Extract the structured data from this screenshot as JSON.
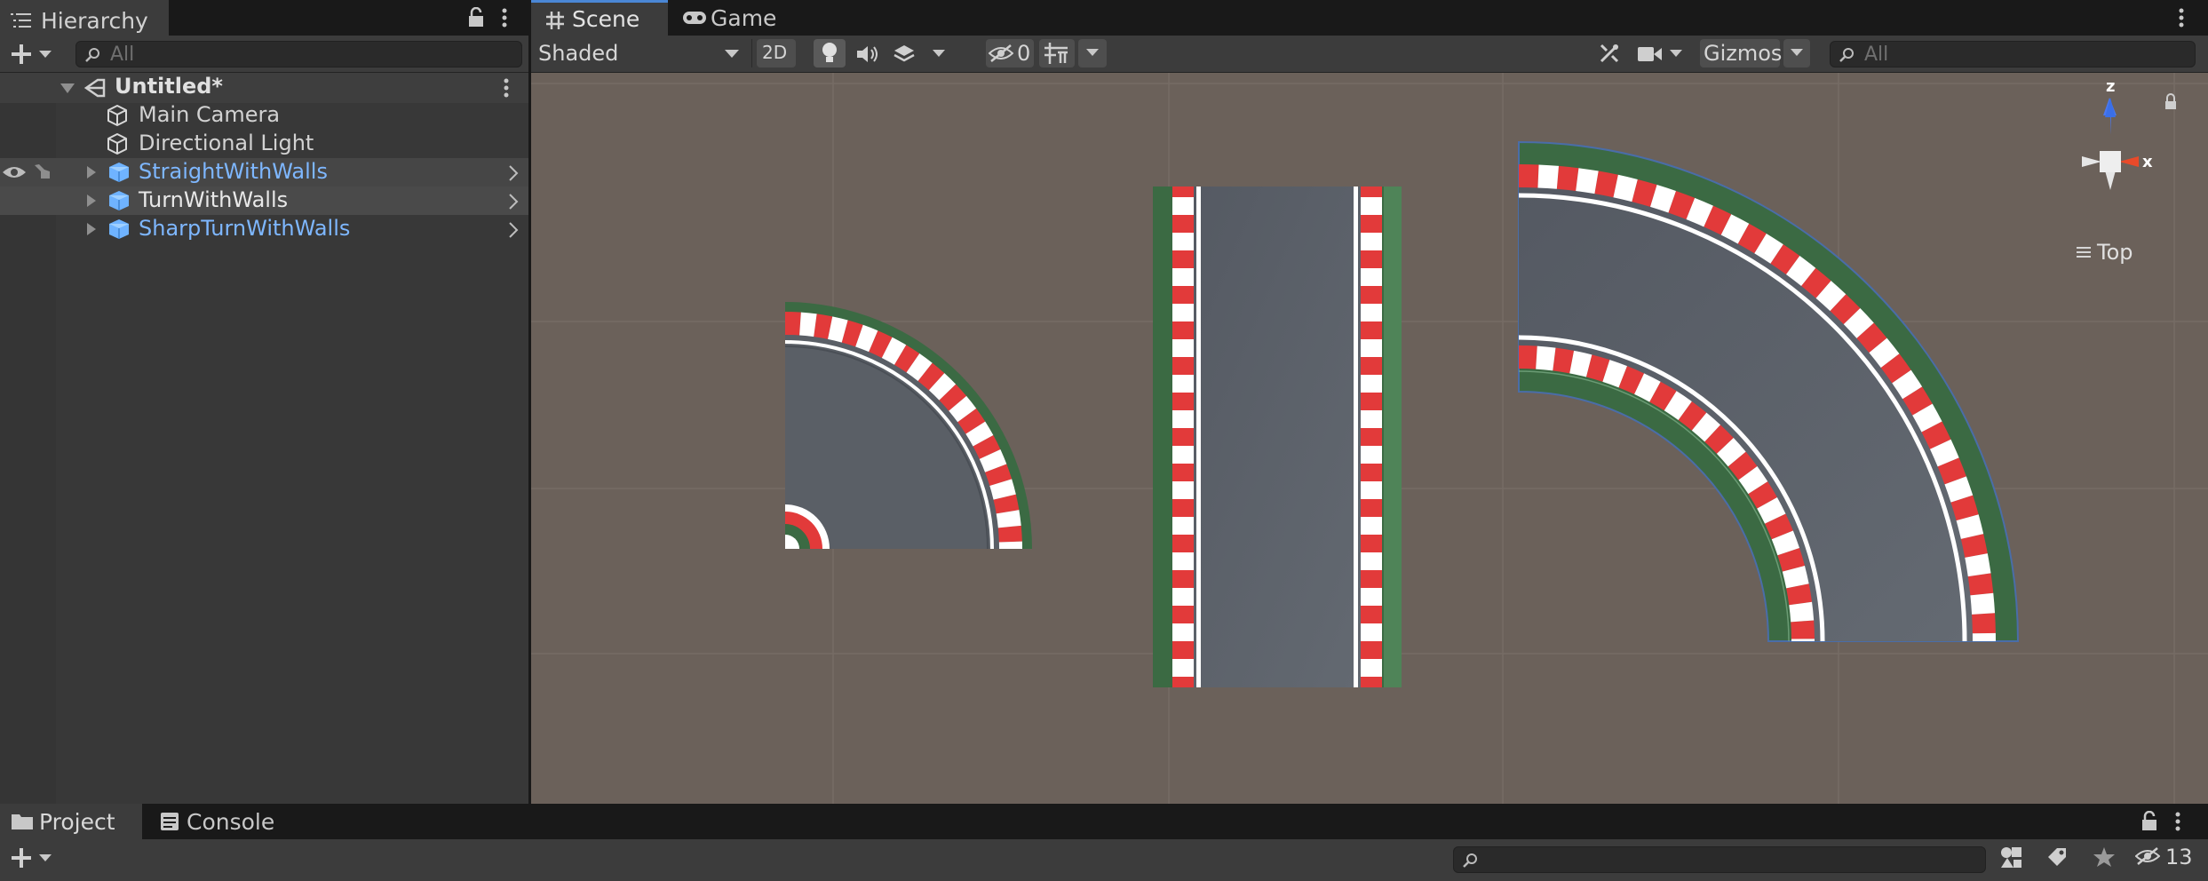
{
  "hierarchy": {
    "tab_label": "Hierarchy",
    "search_placeholder": "All",
    "scene_name": "Untitled*",
    "items": [
      {
        "label": "Main Camera",
        "type": "gameobject"
      },
      {
        "label": "Directional Light",
        "type": "gameobject"
      },
      {
        "label": "StraightWithWalls",
        "type": "prefab"
      },
      {
        "label": "TurnWithWalls",
        "type": "prefab"
      },
      {
        "label": "SharpTurnWithWalls",
        "type": "prefab"
      }
    ]
  },
  "scene_view": {
    "tabs": [
      {
        "label": "Scene",
        "active": true
      },
      {
        "label": "Game",
        "active": false
      }
    ],
    "draw_mode": "Shaded",
    "mode_2d_label": "2D",
    "hidden_count": "0",
    "gizmos_label": "Gizmos",
    "search_placeholder": "All",
    "orientation_label": "Top",
    "gizmo_axes": {
      "z": "z",
      "x": "x"
    }
  },
  "bottom": {
    "tabs": [
      {
        "label": "Project",
        "active": true
      },
      {
        "label": "Console",
        "active": false
      }
    ],
    "hidden_count": "13"
  },
  "colors": {
    "prefab_text": "#7eb7ff",
    "scene_background": "#6b615a",
    "active_tab_accent": "#4a87d6",
    "road": "#5a5f66",
    "grass": "#3b6a43",
    "curb_red": "#e23a3a",
    "curb_white": "#ffffff"
  }
}
